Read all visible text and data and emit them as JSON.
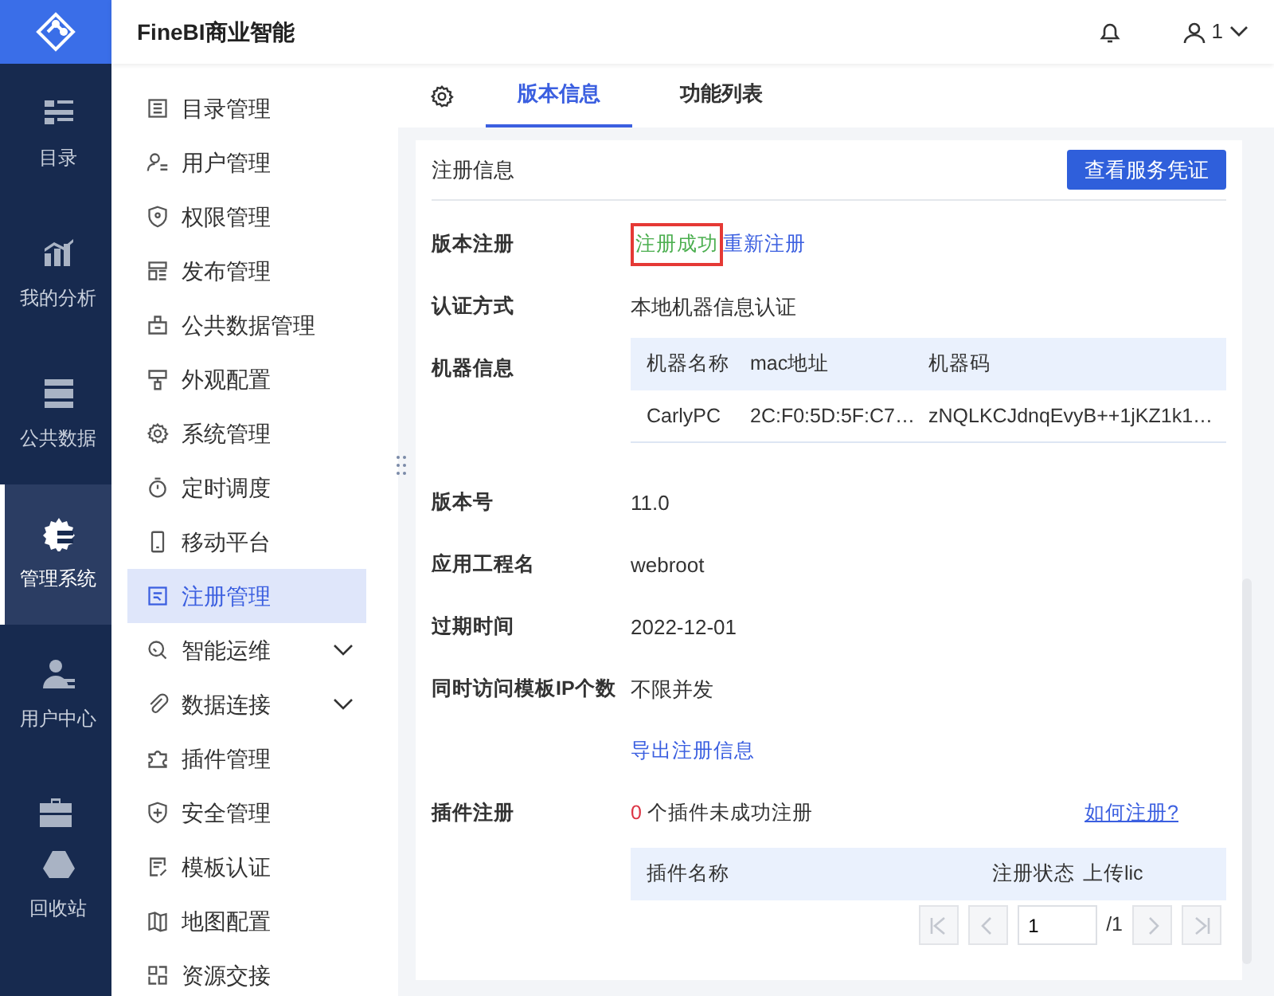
{
  "header": {
    "title": "FineBI商业智能",
    "user": "1"
  },
  "rail": [
    {
      "label": "目录",
      "selected": false
    },
    {
      "label": "我的分析",
      "selected": false
    },
    {
      "label": "公共数据",
      "selected": false
    },
    {
      "label": "管理系统",
      "selected": true
    },
    {
      "label": "用户中心",
      "selected": false
    },
    {
      "label": "回收站",
      "selected": false
    }
  ],
  "menu": [
    {
      "label": "目录管理",
      "selected": false
    },
    {
      "label": "用户管理",
      "selected": false
    },
    {
      "label": "权限管理",
      "selected": false
    },
    {
      "label": "发布管理",
      "selected": false
    },
    {
      "label": "公共数据管理",
      "selected": false
    },
    {
      "label": "外观配置",
      "selected": false
    },
    {
      "label": "系统管理",
      "selected": false
    },
    {
      "label": "定时调度",
      "selected": false
    },
    {
      "label": "移动平台",
      "selected": false
    },
    {
      "label": "注册管理",
      "selected": true
    },
    {
      "label": "智能运维",
      "selected": false,
      "expandable": true
    },
    {
      "label": "数据连接",
      "selected": false,
      "expandable": true
    },
    {
      "label": "插件管理",
      "selected": false
    },
    {
      "label": "安全管理",
      "selected": false
    },
    {
      "label": "模板认证",
      "selected": false
    },
    {
      "label": "地图配置",
      "selected": false
    },
    {
      "label": "资源交接",
      "selected": false
    }
  ],
  "tabs": [
    {
      "label": "版本信息",
      "selected": true
    },
    {
      "label": "功能列表",
      "selected": false
    }
  ],
  "section": {
    "title": "注册信息",
    "button": "查看服务凭证"
  },
  "registration": {
    "label": "版本注册",
    "status": "注册成功",
    "relink": "重新注册"
  },
  "auth": {
    "label": "认证方式",
    "value": "本地机器信息认证"
  },
  "machine": {
    "label": "机器信息",
    "columns": [
      "机器名称",
      "mac地址",
      "机器码"
    ],
    "rows": [
      [
        "CarlyPC",
        "2C:F0:5D:5F:C7…",
        "zNQLKCJdnqEvyB++1jKZ1k1…"
      ]
    ]
  },
  "fields": [
    {
      "label": "版本号",
      "value": "11.0"
    },
    {
      "label": "应用工程名",
      "value": "webroot"
    },
    {
      "label": "过期时间",
      "value": "2022-12-01"
    },
    {
      "label": "同时访问模板IP个数",
      "value": "不限并发"
    }
  ],
  "export_link": "导出注册信息",
  "plugins": {
    "label": "插件注册",
    "count": "0",
    "count_text": "个插件未成功注册",
    "help_link": "如何注册?",
    "columns": [
      "插件名称",
      "注册状态",
      "上传lic"
    ]
  },
  "pagination": {
    "page": "1",
    "total": "/1"
  }
}
